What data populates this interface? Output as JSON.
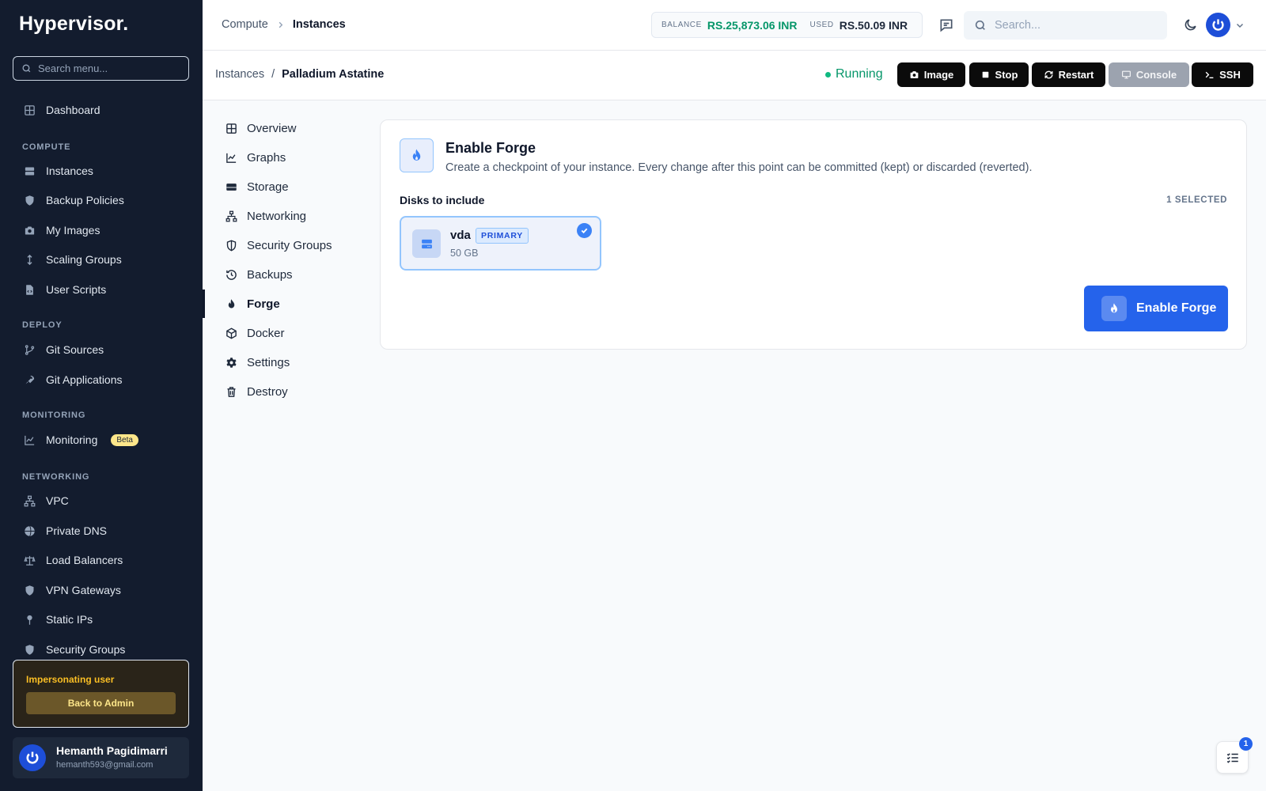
{
  "app": {
    "logo": "Hypervisor."
  },
  "sidebar": {
    "search_placeholder": "Search menu...",
    "dashboard": "Dashboard",
    "sections": {
      "compute": "COMPUTE",
      "deploy": "DEPLOY",
      "monitoring": "MONITORING",
      "networking": "NETWORKING"
    },
    "compute_items": [
      "Instances",
      "Backup Policies",
      "My Images",
      "Scaling Groups",
      "User Scripts"
    ],
    "deploy_items": [
      "Git Sources",
      "Git Applications"
    ],
    "monitoring_item": "Monitoring",
    "beta_badge": "Beta",
    "networking_items": [
      "VPC",
      "Private DNS",
      "Load Balancers",
      "VPN Gateways",
      "Static IPs",
      "Security Groups"
    ],
    "impersonation": {
      "label": "Impersonating user",
      "button": "Back to Admin"
    },
    "user": {
      "name": "Hemanth Pagidimarri",
      "email": "hemanth593@gmail.com"
    }
  },
  "topbar": {
    "breadcrumb": [
      "Compute",
      "Instances"
    ],
    "balance_label": "BALANCE",
    "balance_value": "RS.25,873.06 INR",
    "used_label": "USED",
    "used_value": "RS.50.09 INR",
    "search_placeholder": "Search..."
  },
  "instance": {
    "breadcrumb_parent": "Instances",
    "breadcrumb_sep": "/",
    "name": "Palladium Astatine",
    "status": "Running",
    "actions": {
      "image": "Image",
      "stop": "Stop",
      "restart": "Restart",
      "console": "Console",
      "ssh": "SSH"
    }
  },
  "tabs": [
    "Overview",
    "Graphs",
    "Storage",
    "Networking",
    "Security Groups",
    "Backups",
    "Forge",
    "Docker",
    "Settings",
    "Destroy"
  ],
  "active_tab": "Forge",
  "forge": {
    "title": "Enable Forge",
    "description": "Create a checkpoint of your instance. Every change after this point can be committed (kept) or discarded (reverted).",
    "disks_label": "Disks to include",
    "selected_count": "1 SELECTED",
    "disk": {
      "name": "vda",
      "badge": "PRIMARY",
      "size": "50 GB",
      "selected": true
    },
    "button": "Enable Forge"
  },
  "tasks": {
    "badge": "1"
  },
  "colors": {
    "sidebar_bg": "#131c2e",
    "accent": "#2563eb",
    "running": "#059669",
    "balance": "#059669"
  }
}
